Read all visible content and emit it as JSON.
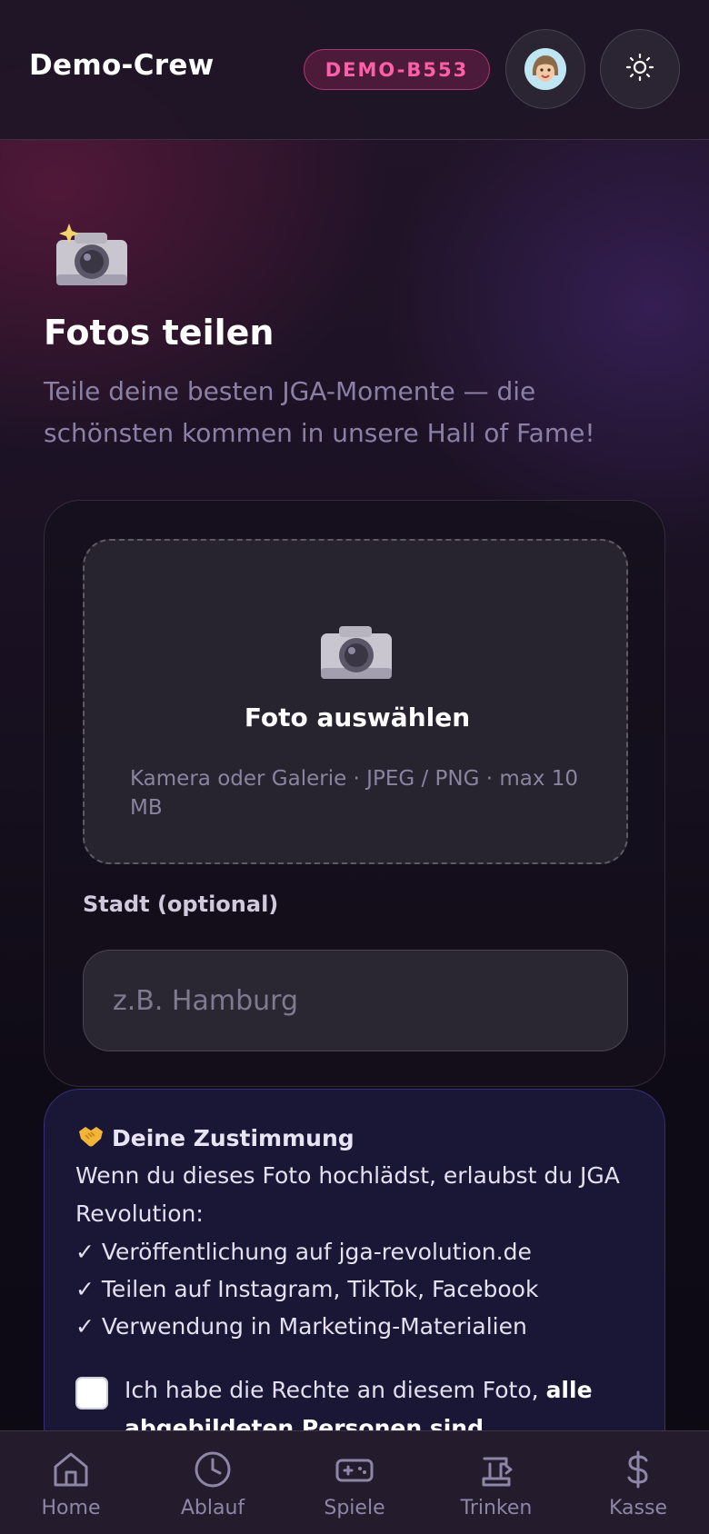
{
  "header": {
    "title": "Demo-Crew",
    "crew_code": "DEMO-B553"
  },
  "icons": {
    "hero": "camera-sparkle-icon",
    "avatar": "avatar-icon",
    "theme": "sun-icon",
    "dropzone": "camera-icon",
    "consent": "handshake-icon"
  },
  "page": {
    "title": "Fotos teilen",
    "subtitle": "Teile deine besten JGA-Momente — die schönsten kommen in unsere Hall of Fame!"
  },
  "upload": {
    "dropzone_title": "Foto auswählen",
    "dropzone_hint": "Kamera oder Galerie · JPEG / PNG · max 10 MB",
    "city_label": "Stadt (optional)",
    "city_placeholder": "z.B. Hamburg",
    "city_value": ""
  },
  "consent": {
    "title": "Deine Zustimmung",
    "intro": "Wenn du dieses Foto hochlädst, erlaubst du JGA Revolution:",
    "items": [
      "✓ Veröffentlichung auf jga-revolution.de",
      "✓ Teilen auf Instagram, TikTok, Facebook",
      "✓ Verwendung in Marketing-Materialien"
    ],
    "checkbox_text": "Ich habe die Rechte an diesem Foto,",
    "checkbox_text_bold": "alle abgebildeten Personen sind einverstanden",
    "checked": false
  },
  "nav": {
    "items": [
      {
        "label": "Home",
        "icon": "home-icon"
      },
      {
        "label": "Ablauf",
        "icon": "clock-icon"
      },
      {
        "label": "Spiele",
        "icon": "gamepad-icon"
      },
      {
        "label": "Trinken",
        "icon": "beer-icon"
      },
      {
        "label": "Kasse",
        "icon": "dollar-icon"
      }
    ]
  },
  "colors": {
    "accent_pink": "#ff5fa8",
    "muted_text": "#8a80a5",
    "consent_border": "#5a50c8"
  }
}
